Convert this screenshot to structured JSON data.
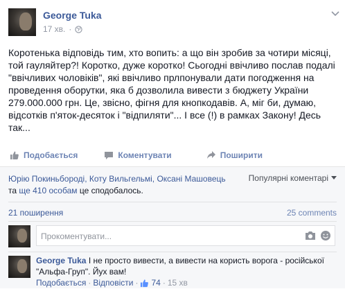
{
  "post": {
    "author": "George Tuka",
    "time": "17 хв.",
    "text": "Коротенька відповідь тим, хто вопить: а що він зробив за чотири місяці, той гауляйтер?! Коротко, дуже коротко! Сьогодні ввічливо послав подалі \"ввічливих чоловіків\", які ввічливо прлпонували дати погодження на проведення оборутки, яка б дозволила вивести з бюджету України 279.000.000 грн. Це, звісно, фігня для кнопкодавів. А, міг би, думаю, відсотків п'яток-десяток і \"відпиляти\"... І все (!) в рамках Закону! Десь так..."
  },
  "actions": {
    "like": "Подобається",
    "comment": "Коментувати",
    "share": "Поширити"
  },
  "likes": {
    "names": "Юрію Покиньбороді, Коту Вильгельмі, Оксані Машовець",
    "and": "та",
    "others": "ще 410 особам",
    "tail": "це сподобалось.",
    "popular_label": "Популярні коментарі"
  },
  "shares": {
    "count": "21 поширення",
    "comments": "25 comments"
  },
  "comment_input": {
    "placeholder": "Прокоментувати..."
  },
  "comment": {
    "author": "George Tuka",
    "text": "І не просто вивести, а вивести на користь ворога - російської \"Альфа-Груп\". Йух вам!",
    "like_label": "Подобається",
    "reply_label": "Відповісти",
    "like_count": "74",
    "time": "15 хв"
  },
  "colors": {
    "link": "#3b5998",
    "action": "#6d84b4",
    "meta": "#9197a3",
    "feedback_bg": "#f6f7f9"
  }
}
